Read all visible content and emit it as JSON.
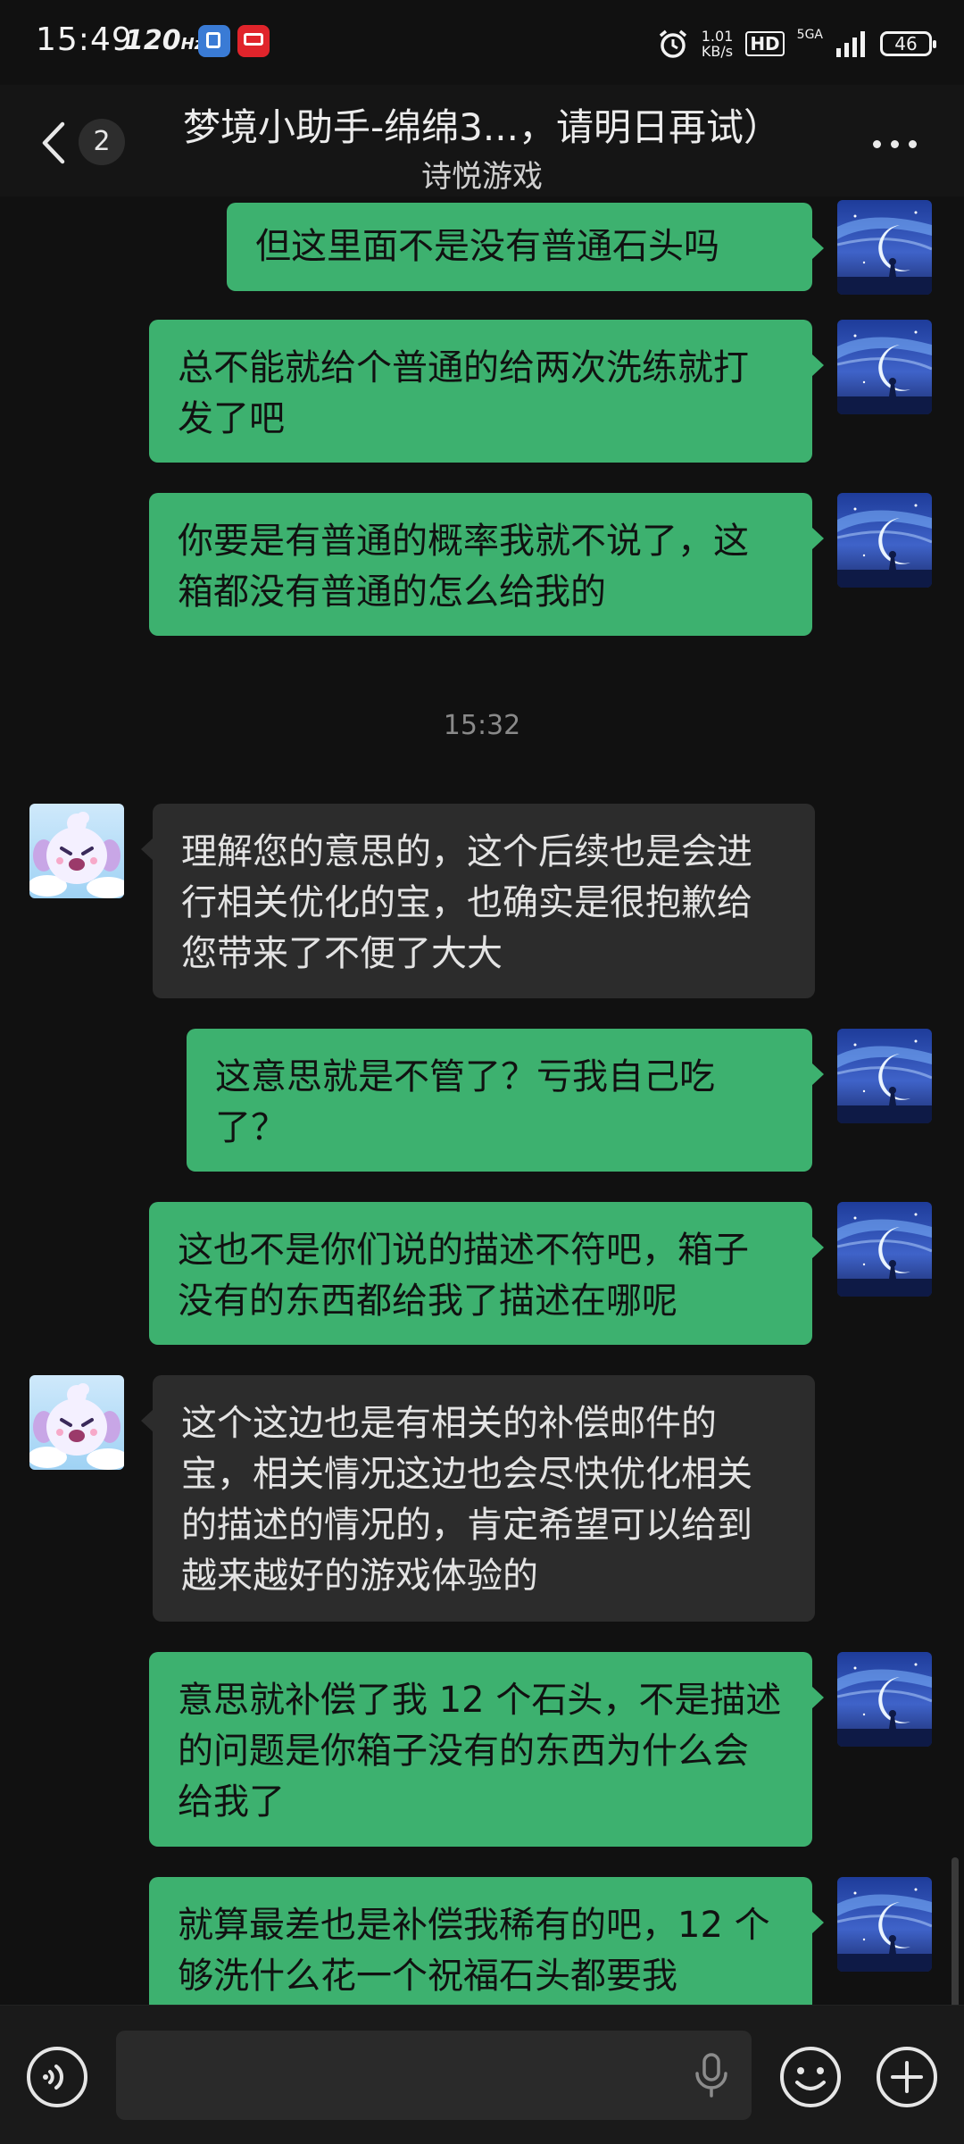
{
  "status_bar": {
    "time": "15:49",
    "refresh_rate": "120",
    "refresh_unit": "Hz",
    "net_speed_value": "1.01",
    "net_speed_unit": "KB/s",
    "hd_label": "HD",
    "network_type": "5GA",
    "battery": "46"
  },
  "header": {
    "back_count": "2",
    "title": "梦境小助手-绵绵3...，请明日再试）",
    "subtitle": "诗悦游戏"
  },
  "messages": [
    {
      "side": "out",
      "text": "但这里面不是没有普通石头吗"
    },
    {
      "side": "out",
      "text": "总不能就给个普通的给两次洗练就打发了吧"
    },
    {
      "side": "out",
      "text": "你要是有普通的概率我就不说了，这箱都没有普通的怎么给我的"
    },
    {
      "timestamp": "15:32"
    },
    {
      "side": "in",
      "text": "理解您的意思的，这个后续也是会进行相关优化的宝，也确实是很抱歉给您带来了不便了大大"
    },
    {
      "side": "out",
      "text": "这意思就是不管了？亏我自己吃了？"
    },
    {
      "side": "out",
      "text": "这也不是你们说的描述不符吧，箱子没有的东西都给我了描述在哪呢"
    },
    {
      "side": "in",
      "text": "这个这边也是有相关的补偿邮件的宝，相关情况这边也会尽快优化相关的描述的情况的，肯定希望可以给到越来越好的游戏体验的"
    },
    {
      "side": "out",
      "text": "意思就补偿了我 12 个石头，不是描述的问题是你箱子没有的东西为什么会给我了"
    },
    {
      "side": "out",
      "text": "就算最差也是补偿我稀有的吧，12 个够洗什么花一个祝福石头都要我"
    }
  ],
  "colors": {
    "background": "#111111",
    "outgoing_bubble": "#3db16f",
    "incoming_bubble": "#2c2c2c"
  }
}
